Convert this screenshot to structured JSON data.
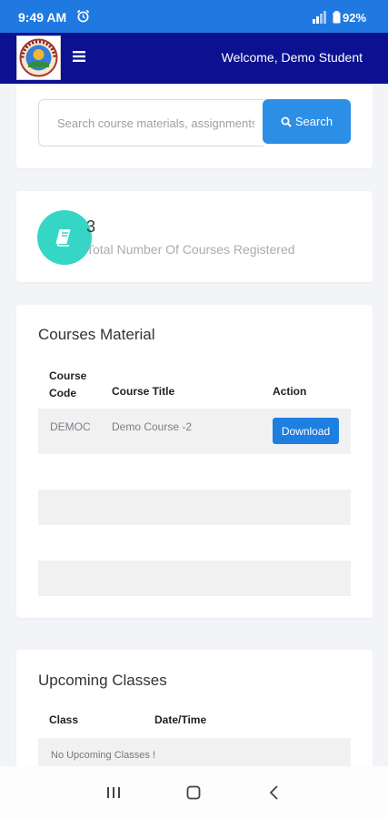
{
  "status_bar": {
    "time": "9:49 AM",
    "battery": "92%",
    "icons": [
      "alarm-icon",
      "signal-icon",
      "battery-icon"
    ]
  },
  "navbar": {
    "welcome_text": "Welcome, Demo Student",
    "icons": [
      "logo",
      "menu-icon"
    ]
  },
  "search": {
    "placeholder": "Search course materials, assignments",
    "button_label": "Search"
  },
  "stats": {
    "count": "3",
    "label": "Total Number Of Courses Registered",
    "icon": "book-icon"
  },
  "materials": {
    "title": "Courses Material",
    "columns": {
      "code_line1": "Course",
      "code_line2": "Code",
      "title": "Course Title",
      "action": "Action"
    },
    "rows": [
      {
        "code": "DEMOC",
        "title": "Demo Course -2",
        "action": "Download"
      }
    ]
  },
  "upcoming": {
    "title": "Upcoming Classes",
    "columns": {
      "class": "Class",
      "datetime": "Date/Time"
    },
    "empty_text": "No Upcoming Classes !"
  },
  "colors": {
    "status_bar": "#1f79e0",
    "navbar": "#0b1190",
    "accent": "#2c8ee5",
    "stats_circle": "#35d6c6"
  }
}
